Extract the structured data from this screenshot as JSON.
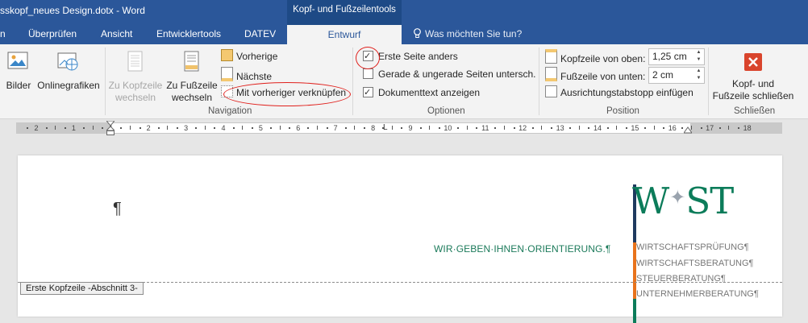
{
  "window": {
    "title": "sskopf_neues Design.dotx - Word",
    "context_tab_group": "Kopf- und Fußzeilentools"
  },
  "tabs": [
    {
      "label": "n"
    },
    {
      "label": "Überprüfen"
    },
    {
      "label": "Ansicht"
    },
    {
      "label": "Entwicklertools"
    },
    {
      "label": "DATEV"
    }
  ],
  "active_tab": "Entwurf",
  "tell_me": "Was möchten Sie tun?",
  "ribbon": {
    "insert": {
      "bilder": "Bilder",
      "onlinegrafiken": "Onlinegrafiken"
    },
    "navigation": {
      "goto_header": [
        "Zu Kopfzeile",
        "wechseln"
      ],
      "goto_footer": [
        "Zu Fußzeile",
        "wechseln"
      ],
      "previous": "Vorherige",
      "next": "Nächste",
      "link_previous": "Mit vorheriger verknüpfen",
      "label": "Navigation"
    },
    "options": {
      "first_page": {
        "label": "Erste Seite anders",
        "checked": true
      },
      "odd_even": {
        "label": "Gerade & ungerade Seiten untersch.",
        "checked": false
      },
      "show_doc": {
        "label": "Dokumenttext anzeigen",
        "checked": true
      },
      "label": "Optionen"
    },
    "position": {
      "header_from_top": {
        "label": "Kopfzeile von oben:",
        "value": "1,25  cm"
      },
      "footer_from_bottom": {
        "label": "Fußzeile von unten:",
        "value": "2  cm"
      },
      "insert_tab": "Ausrichtungstabstopp einfügen",
      "label": "Position"
    },
    "close": {
      "button": [
        "Kopf- und",
        "Fußzeile schließen"
      ],
      "label": "Schließen"
    }
  },
  "ruler": {
    "numbers": [
      "2",
      "1",
      "1",
      "2",
      "3",
      "4",
      "5",
      "6",
      "7",
      "8",
      "9",
      "10",
      "11",
      "12",
      "13",
      "14",
      "15",
      "16",
      "17",
      "18"
    ]
  },
  "document": {
    "pilcrow": "¶",
    "slogan": "WIR·GEBEN·IHNEN·ORIENTIERUNG.¶",
    "logo": {
      "left": "W",
      "right": "ST"
    },
    "services": [
      "WIRTSCHAFTSPRÜFUNG¶",
      "WIRTSCHAFTSBERATUNG¶",
      "STEUERBERATUNG¶",
      "UNTERNEHMERBERATUNG¶"
    ],
    "header_tag": "Erste Kopfzeile -Abschnitt 3-"
  },
  "colors": {
    "word_blue": "#2b579a",
    "annotation_red": "#e0201c",
    "logo_green": "#0c7c5a",
    "bar_navy": "#1f3a5f",
    "bar_orange": "#e8731c",
    "bar_green": "#0c7c5a"
  }
}
